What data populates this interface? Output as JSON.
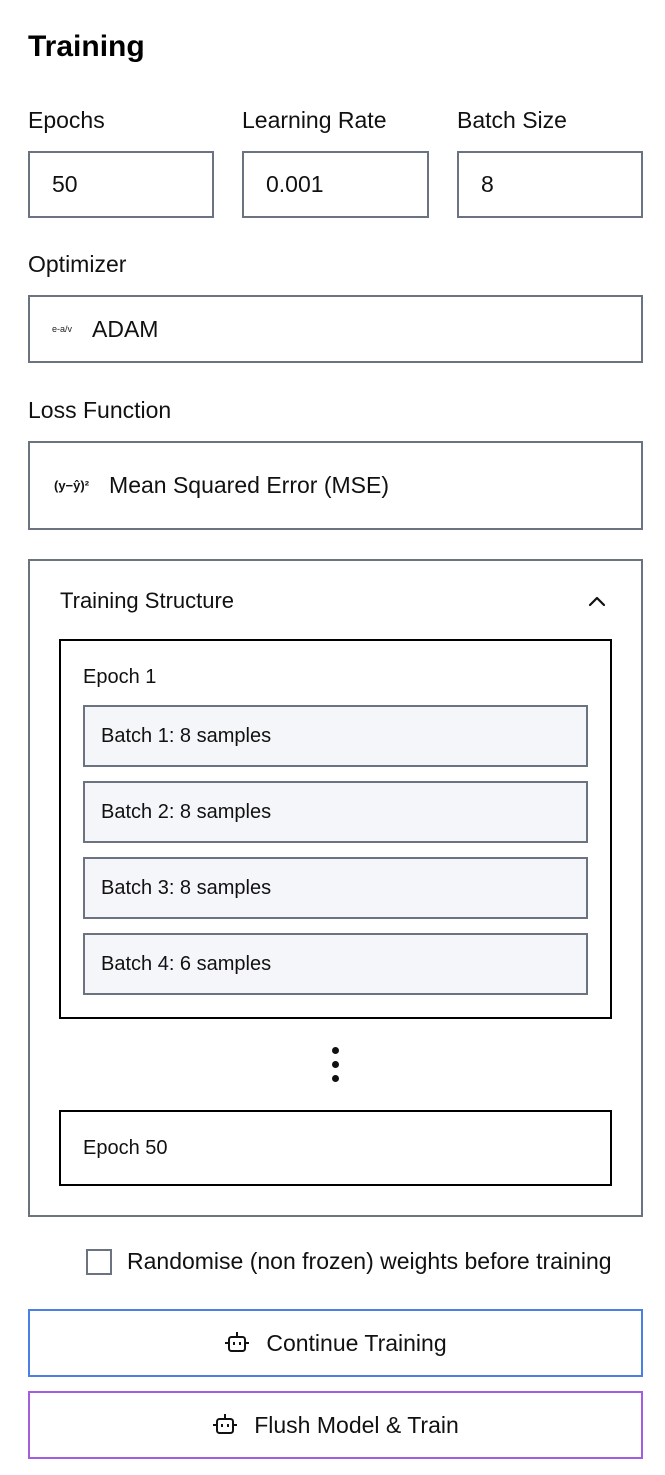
{
  "section": {
    "title": "Training"
  },
  "fields": {
    "epochs": {
      "label": "Epochs",
      "value": "50"
    },
    "learning_rate": {
      "label": "Learning Rate",
      "value": "0.001"
    },
    "batch_size": {
      "label": "Batch Size",
      "value": "8"
    }
  },
  "optimizer": {
    "label": "Optimizer",
    "icon_text": "e-a/v",
    "value": "ADAM"
  },
  "loss": {
    "label": "Loss Function",
    "icon_text": "(y−ŷ)²",
    "value": "Mean Squared Error (MSE)"
  },
  "structure": {
    "title": "Training Structure",
    "first_epoch": "Epoch 1",
    "batches": [
      "Batch 1: 8 samples",
      "Batch 2: 8 samples",
      "Batch 3: 8 samples",
      "Batch 4: 6 samples"
    ],
    "last_epoch": "Epoch 50"
  },
  "randomise": {
    "label": "Randomise (non frozen) weights before training",
    "checked": false
  },
  "buttons": {
    "continue": {
      "label": "Continue Training",
      "border_color": "#4a7fe3"
    },
    "flush": {
      "label": "Flush Model & Train",
      "border_color": "#a35ee0"
    }
  }
}
